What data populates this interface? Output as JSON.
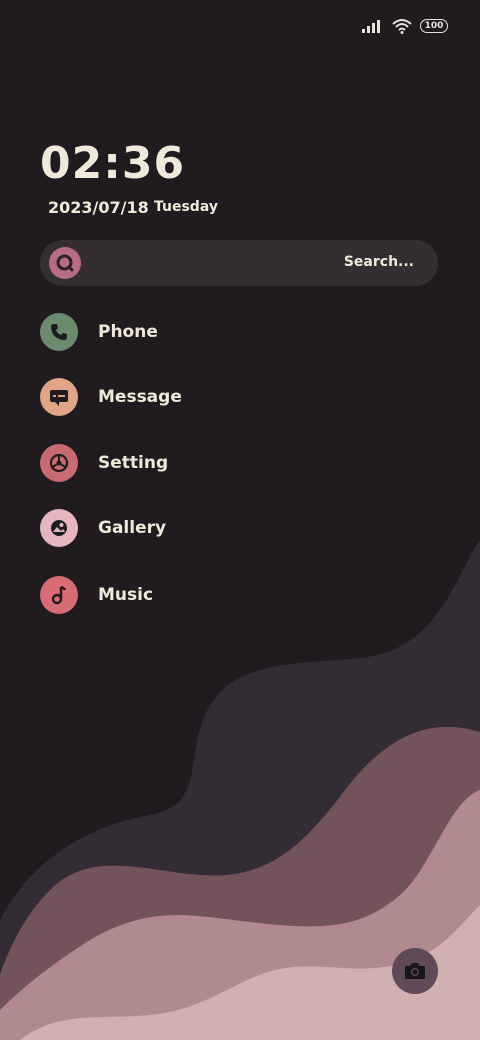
{
  "status_bar": {
    "battery": "100",
    "signal_icon": "signal-icon",
    "wifi_icon": "wifi-icon"
  },
  "clock": {
    "time": "02:36",
    "date": "2023/07/18",
    "weekday": "Tuesday"
  },
  "search": {
    "label": "Search...",
    "icon": "search-icon"
  },
  "apps": [
    {
      "label": "Phone",
      "icon": "phone-icon",
      "color": "#6c8a6e"
    },
    {
      "label": "Message",
      "icon": "message-icon",
      "color": "#e0a486"
    },
    {
      "label": "Setting",
      "icon": "settings-icon",
      "color": "#c86a72"
    },
    {
      "label": "Gallery",
      "icon": "gallery-icon",
      "color": "#e5b6c0"
    },
    {
      "label": "Music",
      "icon": "music-icon",
      "color": "#d86c74"
    }
  ],
  "camera": {
    "icon": "camera-icon"
  },
  "colors": {
    "background": "#1f1b1e",
    "wave1": "#332c35",
    "wave2": "#73535b",
    "wave3": "#b08a8f",
    "wave4": "#d3b0b0",
    "text": "#f0e8d8"
  }
}
